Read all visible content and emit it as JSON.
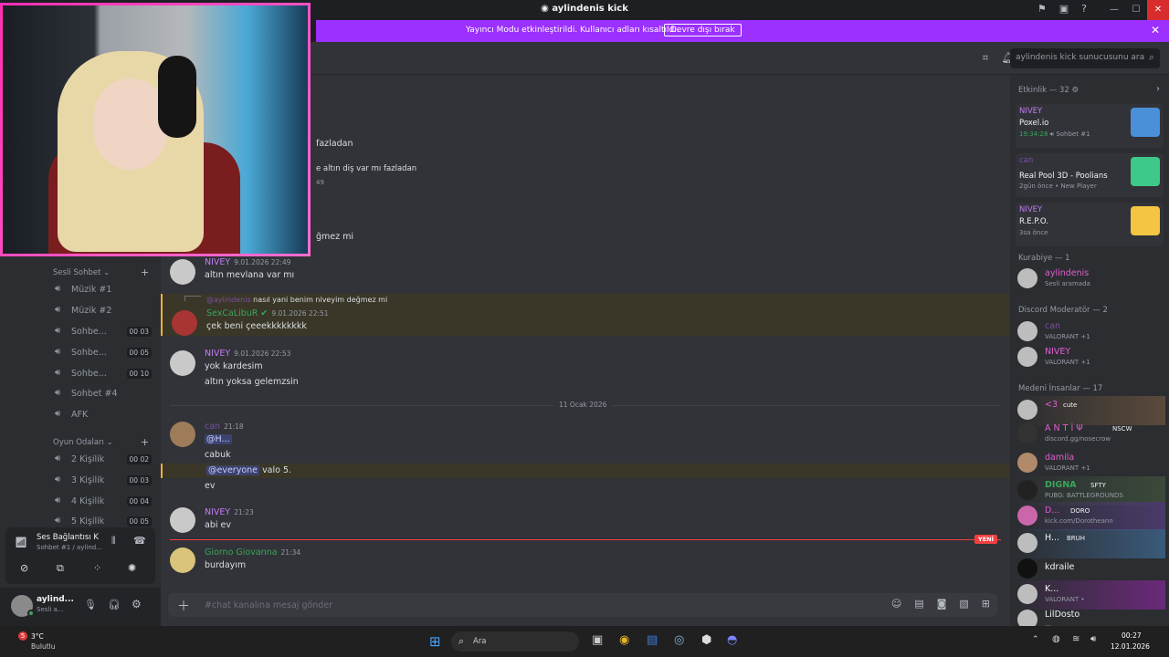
{
  "window": {
    "title": "aylindenis kick"
  },
  "banner": {
    "text": "Yayıncı Modu etkinleştirildi. Kullanıcı adları kısaltıldı.",
    "button": "Devre dışı bırak"
  },
  "search": {
    "placeholder": "aylindenis kick sunucusunu ara"
  },
  "partial_lines": [
    "fazladan",
    "e altın diş var mı fazladan",
    "49",
    "ğmez mi"
  ],
  "sidebar": {
    "voice_header": "Sesli Sohbet",
    "voice_channels": [
      {
        "label": "Müzik #1",
        "count": ""
      },
      {
        "label": "Müzik #2",
        "count": ""
      },
      {
        "label": "Sohbe...",
        "count": "00  03"
      },
      {
        "label": "Sohbe...",
        "count": "00  05"
      },
      {
        "label": "Sohbe...",
        "count": "00  10"
      },
      {
        "label": "Sohbet #4",
        "count": ""
      },
      {
        "label": "AFK",
        "count": ""
      }
    ],
    "game_header": "Oyun Odaları",
    "game_channels": [
      {
        "label": "2 Kişilik",
        "count": "00  02"
      },
      {
        "label": "3 Kişilik",
        "count": "00  03"
      },
      {
        "label": "4 Kişilik",
        "count": "00  04"
      },
      {
        "label": "5 Kişilik",
        "count": "00  05"
      }
    ],
    "voice_status": {
      "title": "Ses Bağlantısı K",
      "subtitle": "Sohbet #1 / aylind..."
    },
    "user": {
      "name": "aylind...",
      "status": "Sesli a..."
    }
  },
  "messages": [
    {
      "author": "NIVEY",
      "time": "9.01.2026 22:49",
      "lines": [
        "altın mevlana var mı"
      ]
    },
    {
      "reply_to": "@aylindenis",
      "reply_text": "nasıl yani benim niveyim değmez mi",
      "author": "SexCaLibuR",
      "time": "9.01.2026 22:51",
      "lines": [
        "çek beni çeeekkkkkkkk"
      ]
    },
    {
      "author": "NIVEY",
      "time": "9.01.2026 22:53",
      "lines": [
        "yok kardesim",
        "altın yoksa gelemzsin"
      ]
    },
    {
      "date_divider": "11 Ocak 2026"
    },
    {
      "author": "can",
      "time": "21:18",
      "mention1": "@H...",
      "line2": "cabuk",
      "mention2": "@everyone",
      "line3": "valo 5.",
      "line4": "ev"
    },
    {
      "author": "NIVEY",
      "time": "21:23",
      "lines": [
        "abi ev"
      ]
    },
    {
      "new_label": "YENİ"
    },
    {
      "author": "Giorno Giovanna",
      "time": "21:34",
      "lines": [
        "burdayım"
      ]
    }
  ],
  "input": {
    "placeholder": "#chat kanalına mesaj gönder"
  },
  "members": {
    "activity_header": "Etkinlik — 32",
    "activities": [
      {
        "name": "NIVEY",
        "game": "Poxel.io",
        "time": "19:34:28",
        "extra": "Sohbet #1"
      },
      {
        "name": "can",
        "game": "Real Pool 3D - Poolians",
        "time": "2gün önce",
        "extra": "New Player"
      },
      {
        "name": "NIVEY",
        "game": "R.E.P.O.",
        "time": "3sa önce",
        "extra": ""
      }
    ],
    "groups": [
      {
        "header": "Kurabiye — 1",
        "items": [
          {
            "name": "aylindenis",
            "status": "Sesli aramada",
            "color": "#e35dd1"
          }
        ]
      },
      {
        "header": "Discord Moderatör — 2",
        "items": [
          {
            "name": "can",
            "status": "VALORANT +1",
            "color": "#7b4fa5"
          },
          {
            "name": "NIVEY",
            "status": "VALORANT +1",
            "color": "#e35dd1"
          }
        ]
      },
      {
        "header": "Medeni İnsanlar — 17",
        "items": [
          {
            "name": "<3",
            "status": "",
            "tag": "cute",
            "color": "#e35dd1"
          },
          {
            "name": "A N T İ Ψ",
            "status": "discord.gg/nosecrow",
            "tag": "NSCW",
            "color": "#e35dd1"
          },
          {
            "name": "damila",
            "status": "VALORANT +1",
            "color": "#e35dd1"
          },
          {
            "name": "DIGNA",
            "status": "PUBG: BATTLEGROUNDS",
            "tag": "SFTY",
            "color": "#e35dd1"
          },
          {
            "name": "D...",
            "status": "kick.com/Dorotheann",
            "tag": "DORO",
            "color": "#e35dd1"
          },
          {
            "name": "H...",
            "status": "",
            "tag": "BRUH",
            "color": "#e35dd1"
          },
          {
            "name": "kdraile",
            "status": "",
            "color": "#e35dd1"
          },
          {
            "name": "K...",
            "status": "VALORANT •",
            "color": "#e35dd1"
          },
          {
            "name": "LilDosto",
            "status": "...",
            "color": "#e35dd1"
          }
        ]
      }
    ]
  },
  "taskbar": {
    "weather_temp": "3°C",
    "weather_text": "Bulutlu",
    "search": "Ara",
    "time": "00:27",
    "date": "12.01.2026",
    "badge": "5"
  },
  "colors": {
    "accent": "#9b30ff",
    "nivey": "#c17cf2",
    "green": "#3ba55c",
    "can": "#7b4fa5"
  }
}
